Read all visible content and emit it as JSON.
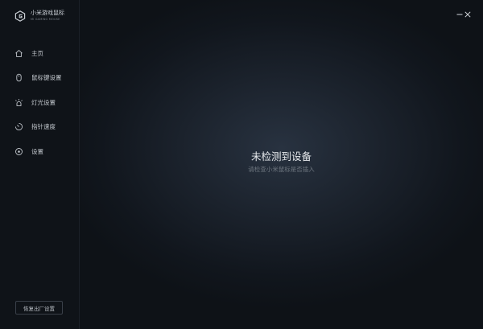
{
  "brand": {
    "title": "小米游戏鼠标",
    "subtitle": "MI GAMING MOUSE"
  },
  "nav": {
    "items": [
      {
        "label": "主页",
        "icon": "home-icon"
      },
      {
        "label": "鼠标键设置",
        "icon": "mouse-icon"
      },
      {
        "label": "灯光设置",
        "icon": "light-icon"
      },
      {
        "label": "指针速度",
        "icon": "speed-gauge-icon"
      },
      {
        "label": "设置",
        "icon": "settings-icon"
      }
    ]
  },
  "footer": {
    "reset_label": "恢复出厂设置"
  },
  "window": {
    "minimize_label": "—",
    "close_label": "✕"
  },
  "main": {
    "status_title": "未检测到设备",
    "status_hint": "请检查小米鼠标是否插入"
  },
  "colors": {
    "sidebar_bg": "#0f1318",
    "main_glow": "#283240",
    "text_primary": "#e6e9ec",
    "text_muted": "#6f7780"
  }
}
